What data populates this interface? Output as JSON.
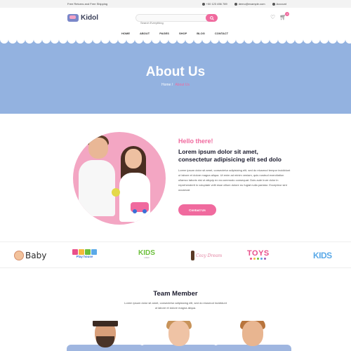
{
  "topbar": {
    "promo": "Free Returns and Free Shipping",
    "phone": "+00 123 456 789",
    "email": "demo@example.com",
    "account": "Account"
  },
  "header": {
    "logo_text": "Kidol",
    "search_placeholder": "Search Everything",
    "cart_count": "0"
  },
  "nav": {
    "items": [
      "HOME",
      "ABOUT",
      "PAGES",
      "SHOP",
      "BLOG",
      "CONTACT"
    ]
  },
  "hero": {
    "title": "About Us",
    "breadcrumb_home": "Home",
    "breadcrumb_sep": "/",
    "breadcrumb_current": "About Us"
  },
  "about": {
    "greeting": "Hello there!",
    "headline": "Lorem ipsum dolor sit amet, consectetur adipisicing elit sed dolo",
    "body": "Lorem ipsum dolor sit amet, consectetur adipisicing elit, sed do eiusmod tempor incididunt ut labore et dolore magna aliqua. Ut enim ad minim veniam, quis nostrud exercitation ullamco laboris nisi ut aliquip ex ea commodo consequat. Duis aute irure dolor in reprehenderit in voluptate velit esse cillum dolore eu fugiat nulla pariatur. Excepteur sint occaecat.",
    "button": "Contact Us"
  },
  "brands": {
    "baby": "Baby",
    "play_house": "Play house",
    "kids": "KIDS",
    "kids_sub": "LOGO",
    "dream": "Cozy Dream",
    "toys": "TOYS",
    "kids2": "KIDS"
  },
  "team": {
    "title": "Team Member",
    "description": "Lorem ipsum dolor sit amet, consectetur adipisicing elit, sed do eiusmod incididunt ut labore et dolore magna aliqua."
  },
  "colors": {
    "accent": "#f06a9e",
    "hero_bg": "#93b2e0",
    "heading": "#1b1b2e"
  }
}
